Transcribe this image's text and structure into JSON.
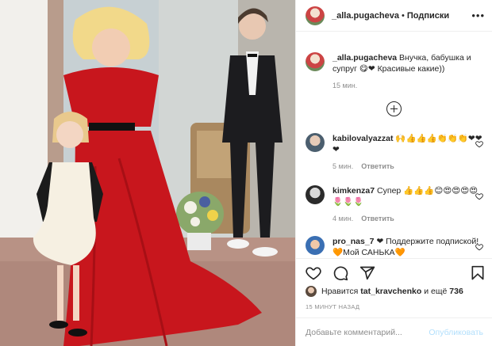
{
  "post": {
    "photo_description_icon": "photo",
    "author": "_alla.pugacheva",
    "separator": "•",
    "follow_status": "Подписки",
    "more_icon": "more-horizontal-icon"
  },
  "caption": {
    "username": "_alla.pugacheva",
    "text": "Внучка, бабушка и супруг 😋❤ Красивые какие))",
    "time": "15 мин."
  },
  "comments": [
    {
      "username": "kabilovalyazzat",
      "text": "🙌👍👍👍👏👏👏❤❤❤",
      "time": "5 мин.",
      "reply": "Ответить"
    },
    {
      "username": "kimkenza7",
      "text": "Супер 👍👍👍😊😍😍😍😍🌷🌷🌷",
      "time": "4 мин.",
      "reply": "Ответить"
    },
    {
      "username": "pro_nas_7",
      "text": "❤ Поддержите подпиской!🧡Мой САНЬКА🧡",
      "time": "",
      "reply": ""
    }
  ],
  "likes": {
    "prefix": "Нравится",
    "liker": "tat_kravchenko",
    "connector": "и ещё",
    "count": "736"
  },
  "timestamp": "15 МИНУТ НАЗАД",
  "add_comment": {
    "placeholder": "Добавьте комментарий...",
    "publish_label": "Опубликовать"
  },
  "colors": {
    "text": "#262626",
    "muted": "#8e8e8e",
    "publish_disabled": "#b2dffc",
    "heart_red": "#ed4956",
    "dress_red": "#c8161d"
  }
}
